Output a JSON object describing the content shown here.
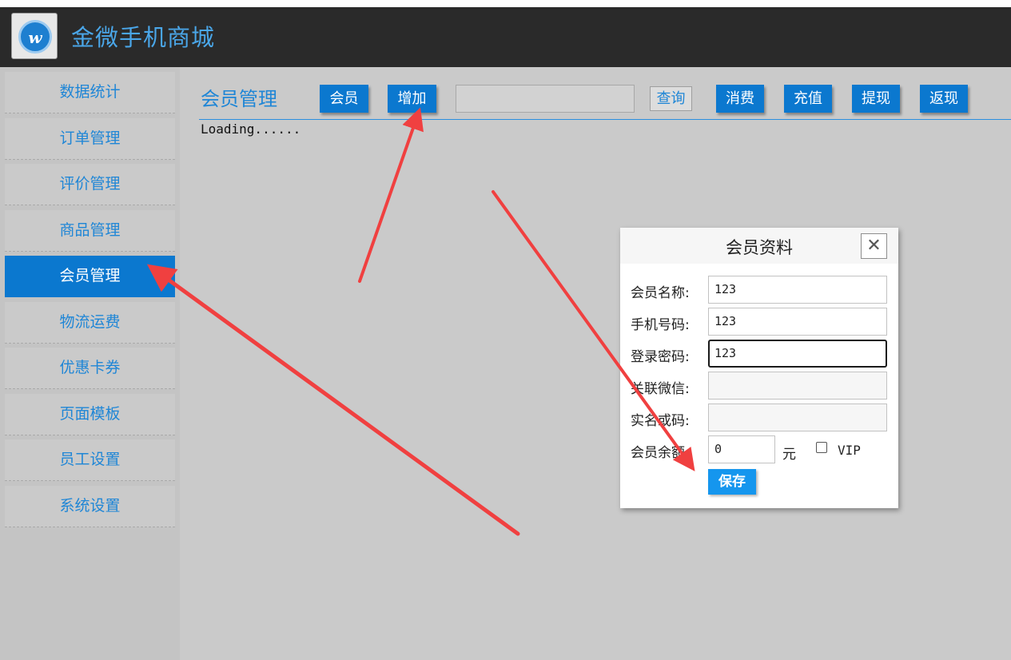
{
  "header": {
    "app_title": "金微手机商城",
    "logo_icon": "w-logo-icon"
  },
  "sidebar": {
    "items": [
      {
        "label": "数据统计"
      },
      {
        "label": "订单管理"
      },
      {
        "label": "评价管理"
      },
      {
        "label": "商品管理"
      },
      {
        "label": "会员管理",
        "active": true
      },
      {
        "label": "物流运费"
      },
      {
        "label": "优惠卡券"
      },
      {
        "label": "页面模板"
      },
      {
        "label": "员工设置"
      },
      {
        "label": "系统设置"
      }
    ]
  },
  "main": {
    "title": "会员管理",
    "toolbar": {
      "member_label": "会员",
      "add_label": "增加",
      "search_value": "",
      "query_label": "查询",
      "consume_label": "消费",
      "recharge_label": "充值",
      "withdraw_label": "提现",
      "rebate_label": "返现"
    },
    "loading_text": "Loading......"
  },
  "modal": {
    "title": "会员资料",
    "close_icon": "close-icon",
    "fields": {
      "name_label": "会员名称:",
      "name_value": "123",
      "phone_label": "手机号码:",
      "phone_value": "123",
      "password_label": "登录密码:",
      "password_value": "123",
      "wechat_label": "关联微信:",
      "wechat_value": "",
      "realname_label": "实名或码:",
      "realname_value": "",
      "balance_label": "会员余额:",
      "balance_value": "0",
      "unit_label": "元",
      "vip_label": "VIP",
      "vip_checked": false
    },
    "save_label": "保存"
  },
  "colors": {
    "accent": "#0b78cf",
    "topbar": "#2a2a2a",
    "sidebar_bg": "#c4c4c4",
    "main_bg": "#cacaca",
    "annotation_arrow": "#f04040"
  }
}
